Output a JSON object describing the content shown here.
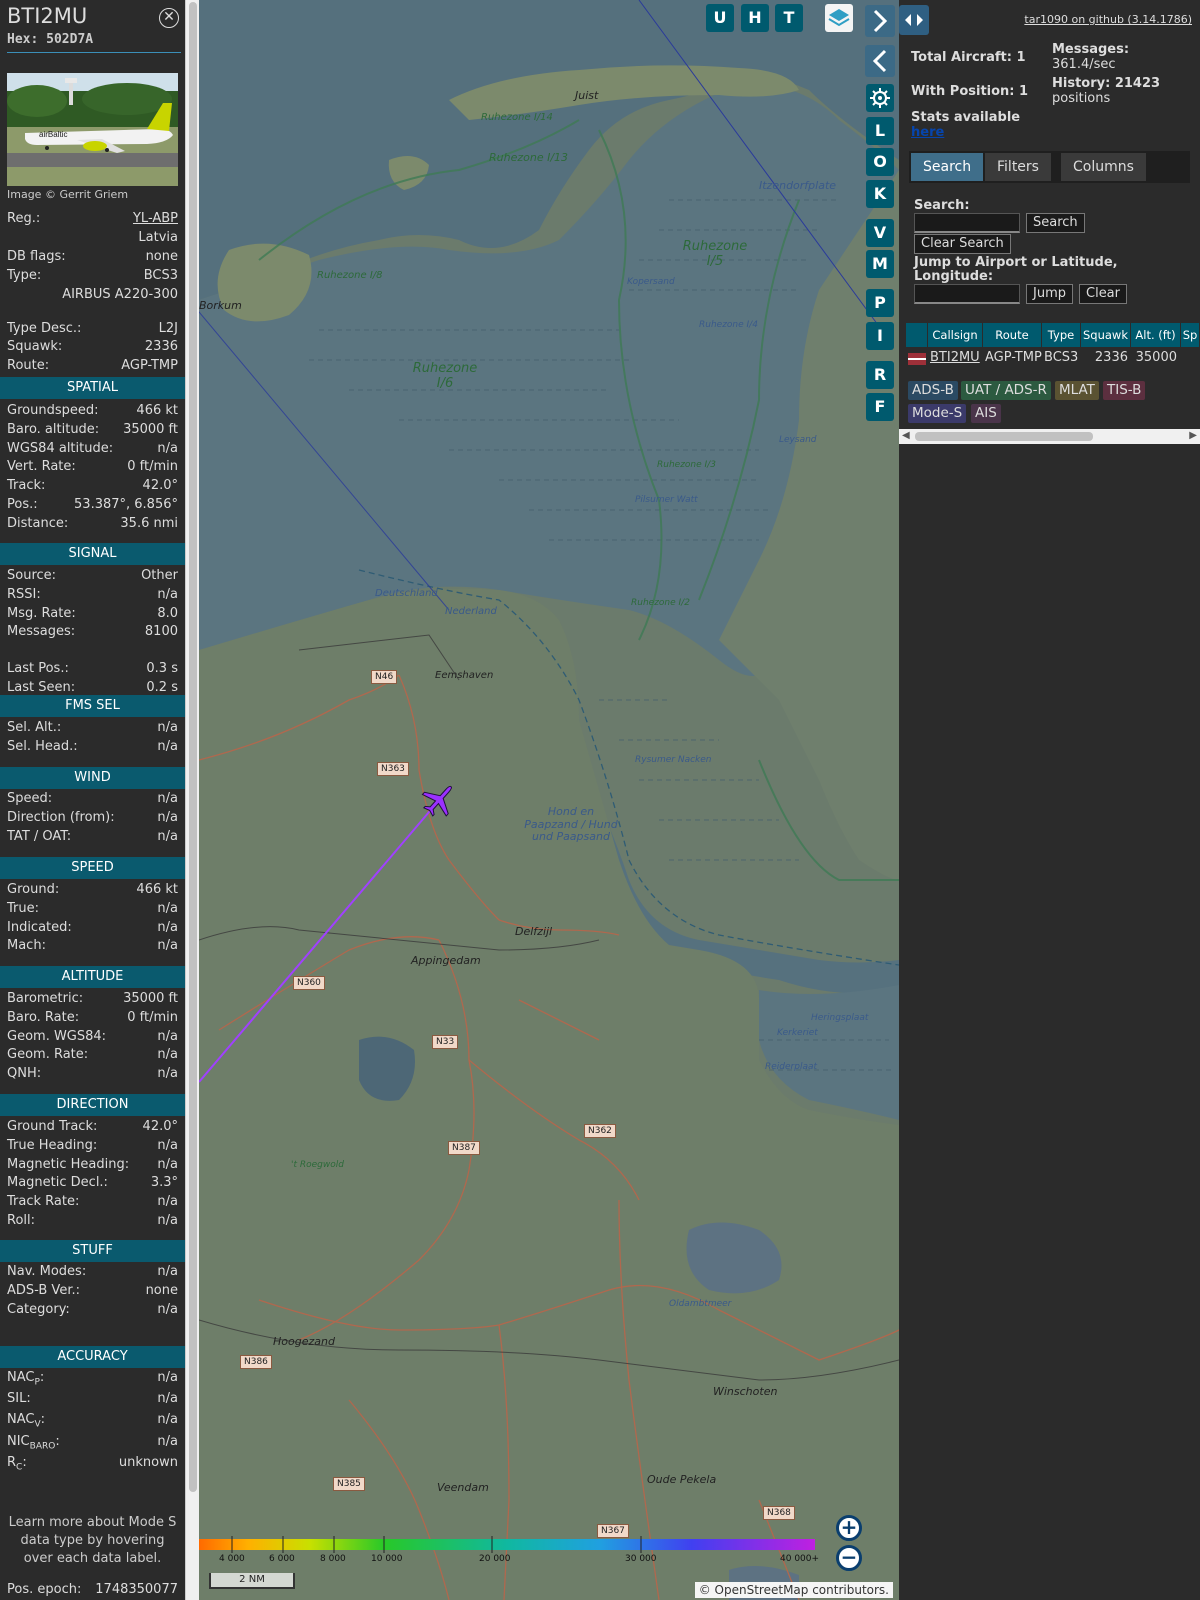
{
  "info": {
    "callsign": "BTI2MU",
    "hex": "Hex: 502D7A",
    "close_icon": "close-icon",
    "photo_credit": "Image © Gerrit Griem",
    "general": [
      {
        "k": "Reg.:",
        "v": "YL-ABP"
      },
      {
        "k": "",
        "v": "Latvia"
      },
      {
        "k": "DB flags:",
        "v": "none"
      },
      {
        "k": "Type:",
        "v": "BCS3"
      },
      {
        "k": "",
        "v": "AIRBUS A220-300"
      },
      {
        "k": "Type Desc.:",
        "v": "L2J"
      },
      {
        "k": "Squawk:",
        "v": "2336"
      },
      {
        "k": "Route:",
        "v": "AGP-TMP"
      }
    ],
    "spatial_title": "SPATIAL",
    "spatial": [
      {
        "k": "Groundspeed:",
        "v": "466 kt"
      },
      {
        "k": "Baro. altitude:",
        "v": "35000 ft"
      },
      {
        "k": "WGS84 altitude:",
        "v": "n/a"
      },
      {
        "k": "Vert. Rate:",
        "v": "0 ft/min"
      },
      {
        "k": "Track:",
        "v": "42.0°"
      },
      {
        "k": "Pos.:",
        "v": "53.387°, 6.856°"
      },
      {
        "k": "Distance:",
        "v": "35.6 nmi"
      }
    ],
    "signal_title": "SIGNAL",
    "signal": [
      {
        "k": "Source:",
        "v": "Other"
      },
      {
        "k": "RSSI:",
        "v": "n/a"
      },
      {
        "k": "Msg. Rate:",
        "v": "8.0"
      },
      {
        "k": "Messages:",
        "v": "8100"
      },
      {
        "k": "Last Pos.:",
        "v": "0.3 s"
      },
      {
        "k": "Last Seen:",
        "v": "0.2 s"
      }
    ],
    "fms_title": "FMS SEL",
    "fms": [
      {
        "k": "Sel. Alt.:",
        "v": "n/a"
      },
      {
        "k": "Sel. Head.:",
        "v": "n/a"
      }
    ],
    "wind_title": "WIND",
    "wind": [
      {
        "k": "Speed:",
        "v": "n/a"
      },
      {
        "k": "Direction (from):",
        "v": "n/a"
      },
      {
        "k": "TAT / OAT:",
        "v": "n/a"
      }
    ],
    "speed_title": "SPEED",
    "speed": [
      {
        "k": "Ground:",
        "v": "466 kt"
      },
      {
        "k": "True:",
        "v": "n/a"
      },
      {
        "k": "Indicated:",
        "v": "n/a"
      },
      {
        "k": "Mach:",
        "v": "n/a"
      }
    ],
    "altitude_title": "ALTITUDE",
    "altitude": [
      {
        "k": "Barometric:",
        "v": "35000 ft"
      },
      {
        "k": "Baro. Rate:",
        "v": "0 ft/min"
      },
      {
        "k": "Geom. WGS84:",
        "v": "n/a"
      },
      {
        "k": "Geom. Rate:",
        "v": "n/a"
      },
      {
        "k": "QNH:",
        "v": "n/a"
      }
    ],
    "direction_title": "DIRECTION",
    "direction": [
      {
        "k": "Ground Track:",
        "v": "42.0°"
      },
      {
        "k": "True Heading:",
        "v": "n/a"
      },
      {
        "k": "Magnetic Heading:",
        "v": "n/a"
      },
      {
        "k": "Magnetic Decl.:",
        "v": "3.3°"
      },
      {
        "k": "Track Rate:",
        "v": "n/a"
      },
      {
        "k": "Roll:",
        "v": "n/a"
      }
    ],
    "stuff_title": "STUFF",
    "stuff": [
      {
        "k": "Nav. Modes:",
        "v": "n/a"
      },
      {
        "k": "ADS-B Ver.:",
        "v": "none"
      },
      {
        "k": "Category:",
        "v": "n/a"
      }
    ],
    "accuracy_title": "ACCURACY",
    "accuracy": [
      {
        "k": "NAC",
        "sub": "P",
        "v": "n/a"
      },
      {
        "k": "SIL:",
        "sub": "",
        "v": "n/a"
      },
      {
        "k": "NAC",
        "sub": "V",
        "v": "n/a"
      },
      {
        "k": "NIC",
        "sub": "BARO",
        "v": "n/a"
      },
      {
        "k": "R",
        "sub": "C",
        "v": "unknown"
      }
    ],
    "note": "Learn more about Mode S data type by hovering over each data label.",
    "epoch_label": "Pos. epoch:",
    "epoch_value": "1748350077"
  },
  "map": {
    "top_buttons": [
      "U",
      "H",
      "T"
    ],
    "side_buttons": [
      "L",
      "O",
      "K",
      "V",
      "M",
      "P",
      "I",
      "R",
      "F"
    ],
    "layers_icon": "layers-icon",
    "settings_icon": "gear-icon",
    "expand_icon": "chevron-right-icon",
    "collapse_icon": "chevron-left-icon",
    "resize_icon": "resize-horizontal-icon",
    "labels": [
      {
        "t": "Juist"
      },
      {
        "t": "Ruhezone I/14"
      },
      {
        "t": "Ruhezone I/13"
      },
      {
        "t": "Ruhezone I/5"
      },
      {
        "t": "Itzendorfplate"
      },
      {
        "t": "Ruhezone I/8"
      },
      {
        "t": "Borkum"
      },
      {
        "t": "Ruhezone I/6"
      },
      {
        "t": "Kopersand"
      },
      {
        "t": "Ruhezone I/4"
      },
      {
        "t": "Leysand"
      },
      {
        "t": "Ruhezone I/3"
      },
      {
        "t": "Pilsumer Watt"
      },
      {
        "t": "Ruhezone I/2"
      },
      {
        "t": "Deutschland"
      },
      {
        "t": "Nederland"
      },
      {
        "t": "Eemshaven"
      },
      {
        "t": "Rysumer Nacken"
      },
      {
        "t": "Hond en Paapzand / Hund und Paapsand"
      },
      {
        "t": "Delfzijl"
      },
      {
        "t": "Appingedam"
      },
      {
        "t": "Heringsplaat"
      },
      {
        "t": "Kerkeriet"
      },
      {
        "t": "Reiderplaat"
      },
      {
        "t": "Hoogezand"
      },
      {
        "t": "Oldambtmeer"
      },
      {
        "t": "Winschoten"
      },
      {
        "t": "Veendam"
      },
      {
        "t": "Oude Pekela"
      },
      {
        "t": "'t Roegwold"
      }
    ],
    "road_labels": [
      "N46",
      "N363",
      "N360",
      "N33",
      "N387",
      "N362",
      "N386",
      "N385",
      "N367",
      "N368"
    ],
    "altitude_scale": [
      "4 000",
      "6 000",
      "8 000",
      "10 000",
      "20 000",
      "30 000",
      "40 000+"
    ],
    "scale_label": "2 NM",
    "zoom_in": "+",
    "zoom_out": "−",
    "attribution": "© OpenStreetMap contributors.",
    "track_color": "#a040ff",
    "aircraft_color": "#9b30ff"
  },
  "side": {
    "github_link": "tar1090 on github (3.14.1786)",
    "total_aircraft": "Total Aircraft: 1",
    "with_position": "With Position: 1",
    "messages_label": "Messages:",
    "messages_value": "361.4/sec",
    "history_label": "History: 21423",
    "history_value": "positions",
    "stats_label": "Stats available",
    "stats_link": "here",
    "tabs": [
      "Search",
      "Filters",
      "Columns"
    ],
    "search_label": "Search:",
    "search_button": "Search",
    "clear_search_button": "Clear Search",
    "jump_label": "Jump to Airport or Latitude, Longitude:",
    "jump_button": "Jump",
    "clear_button": "Clear",
    "table_headers": [
      "Callsign",
      "Route",
      "Type",
      "Squawk",
      "Alt. (ft)",
      "Sp"
    ],
    "table_row": {
      "callsign": "BTI2MU",
      "route": "AGP-TMP",
      "type": "BCS3",
      "squawk": "2336",
      "alt": "35000"
    },
    "flag_icon": "latvia-flag-icon",
    "chips": [
      {
        "t": "ADS-B",
        "c": "#2b4a63"
      },
      {
        "t": "UAT / ADS-R",
        "c": "#2c5a40"
      },
      {
        "t": "MLAT",
        "c": "#5a5232"
      },
      {
        "t": "TIS-B",
        "c": "#5c2f3f"
      },
      {
        "t": "Mode-S",
        "c": "#3b3a6a"
      },
      {
        "t": "AIS",
        "c": "#4a344a"
      }
    ]
  }
}
